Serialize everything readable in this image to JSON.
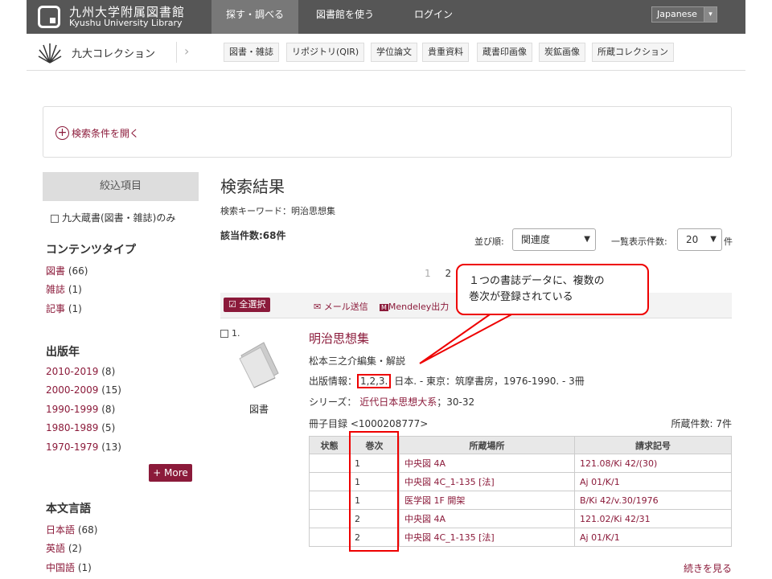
{
  "header": {
    "logo_jp": "九州大学附属図書館",
    "logo_en": "Kyushu University Library",
    "nav": [
      "探す・調べる",
      "図書館を使う",
      "ログイン"
    ],
    "language": "Japanese"
  },
  "collection_bar": {
    "title": "九大コレクション",
    "tabs": [
      "図書・雑誌",
      "リポジトリ(QIR)",
      "学位論文",
      "貴重資料",
      "蔵書印画像",
      "炭鉱画像",
      "所蔵コレクション"
    ]
  },
  "search": {
    "open_label": "検索条件を開く"
  },
  "sidebar": {
    "header": "絞込項目",
    "kyudai_only": "九大蔵書(図書・雑誌)のみ",
    "content_type": {
      "title": "コンテンツタイプ",
      "items": [
        {
          "label": "図書",
          "count": "(66)"
        },
        {
          "label": "雑誌",
          "count": "(1)"
        },
        {
          "label": "記事",
          "count": "(1)"
        }
      ]
    },
    "pub_year": {
      "title": "出版年",
      "items": [
        {
          "label": "2010-2019",
          "count": "(8)"
        },
        {
          "label": "2000-2009",
          "count": "(15)"
        },
        {
          "label": "1990-1999",
          "count": "(8)"
        },
        {
          "label": "1980-1989",
          "count": "(5)"
        },
        {
          "label": "1970-1979",
          "count": "(13)"
        }
      ],
      "more": "+ More"
    },
    "language": {
      "title": "本文言語",
      "items": [
        {
          "label": "日本語",
          "count": "(68)"
        },
        {
          "label": "英語",
          "count": "(2)"
        },
        {
          "label": "中国語",
          "count": "(1)"
        }
      ]
    }
  },
  "results": {
    "title": "検索結果",
    "keyword": "検索キーワード：明治思想集",
    "count": "該当件数:68件",
    "sort_label": "並び順:",
    "sort_value": "関連度",
    "perpage_label": "一覧表示件数:",
    "perpage_value": "20",
    "perpage_unit": "件",
    "pages": [
      "1",
      "2"
    ],
    "select_all": "全選択",
    "mail": "メール送信",
    "mendeley": "Mendeley出力"
  },
  "record": {
    "num": "1.",
    "type": "図書",
    "title": "明治思想集",
    "author": "松本三之介編集・解説",
    "pub_prefix": "出版情報：",
    "pub_volumes": "1,2,3.",
    "pub_rest": " 日本. - 東京：筑摩書房，1976-1990. - 3冊",
    "series_label": "シリーズ：",
    "series_link": "近代日本思想大系",
    "series_rest": "；30-32",
    "subcatalog": "冊子目録 <1000208777>",
    "holdings": "所蔵件数: 7件",
    "table_headers": [
      "状態",
      "巻次",
      "所蔵場所",
      "請求記号"
    ],
    "rows": [
      {
        "status": "",
        "vol": "1",
        "loc": "中央図 4A",
        "cl": "121.08/Ki 42/(30)"
      },
      {
        "status": "",
        "vol": "1",
        "loc": "中央図 4C_1-135 [法]",
        "cl": "Aj 01/K/1"
      },
      {
        "status": "",
        "vol": "1",
        "loc": "医学図 1F 開架",
        "cl": "B/Ki 42/v.30/1976"
      },
      {
        "status": "",
        "vol": "2",
        "loc": "中央図 4A",
        "cl": "121.02/Ki 42/31"
      },
      {
        "status": "",
        "vol": "2",
        "loc": "中央図 4C_1-135 [法]",
        "cl": "Aj 01/K/1"
      }
    ],
    "more_link": "続きを見る"
  },
  "annotation": {
    "callout_line1": "１つの書誌データに、複数の",
    "callout_line2": "巻次が登録されている",
    "color": "#e00000"
  }
}
